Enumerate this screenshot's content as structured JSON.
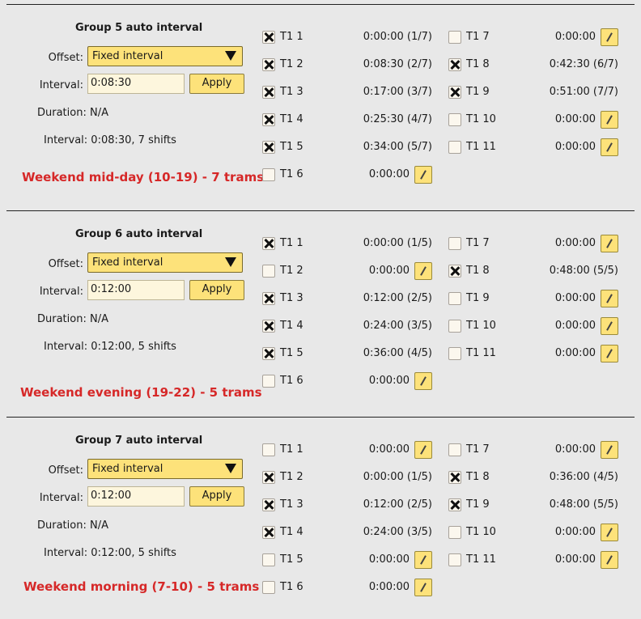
{
  "common": {
    "offset_label": "Offset:",
    "interval_label": "Interval:",
    "apply_label": "Apply",
    "duration_text": "Duration: N/A"
  },
  "groups": [
    {
      "title": "Group 5 auto interval",
      "offset_value": "Fixed interval",
      "interval_value": "0:08:30",
      "interval_info": "Interval: 0:08:30, 7 shifts",
      "footer": "Weekend mid-day (10-19) - 7 trams",
      "trams": [
        {
          "label": "T1 1",
          "checked": true,
          "value": "0:00:00 (1/7)"
        },
        {
          "label": "T1 2",
          "checked": true,
          "value": "0:08:30 (2/7)"
        },
        {
          "label": "T1 3",
          "checked": true,
          "value": "0:17:00 (3/7)"
        },
        {
          "label": "T1 4",
          "checked": true,
          "value": "0:25:30 (4/7)"
        },
        {
          "label": "T1 5",
          "checked": true,
          "value": "0:34:00 (5/7)"
        },
        {
          "label": "T1 6",
          "checked": false,
          "value": "0:00:00"
        },
        {
          "label": "T1 7",
          "checked": false,
          "value": "0:00:00"
        },
        {
          "label": "T1 8",
          "checked": true,
          "value": "0:42:30 (6/7)"
        },
        {
          "label": "T1 9",
          "checked": true,
          "value": "0:51:00 (7/7)"
        },
        {
          "label": "T1 10",
          "checked": false,
          "value": "0:00:00"
        },
        {
          "label": "T1 11",
          "checked": false,
          "value": "0:00:00"
        }
      ]
    },
    {
      "title": "Group 6 auto interval",
      "offset_value": "Fixed interval",
      "interval_value": "0:12:00",
      "interval_info": "Interval: 0:12:00, 5 shifts",
      "footer": "Weekend evening (19-22) - 5 trams",
      "trams": [
        {
          "label": "T1 1",
          "checked": true,
          "value": "0:00:00 (1/5)"
        },
        {
          "label": "T1 2",
          "checked": false,
          "value": "0:00:00"
        },
        {
          "label": "T1 3",
          "checked": true,
          "value": "0:12:00 (2/5)"
        },
        {
          "label": "T1 4",
          "checked": true,
          "value": "0:24:00 (3/5)"
        },
        {
          "label": "T1 5",
          "checked": true,
          "value": "0:36:00 (4/5)"
        },
        {
          "label": "T1 6",
          "checked": false,
          "value": "0:00:00"
        },
        {
          "label": "T1 7",
          "checked": false,
          "value": "0:00:00"
        },
        {
          "label": "T1 8",
          "checked": true,
          "value": "0:48:00 (5/5)"
        },
        {
          "label": "T1 9",
          "checked": false,
          "value": "0:00:00"
        },
        {
          "label": "T1 10",
          "checked": false,
          "value": "0:00:00"
        },
        {
          "label": "T1 11",
          "checked": false,
          "value": "0:00:00"
        }
      ]
    },
    {
      "title": "Group 7 auto interval",
      "offset_value": "Fixed interval",
      "interval_value": "0:12:00",
      "interval_info": "Interval: 0:12:00, 5 shifts",
      "footer": "Weekend morning (7-10) - 5 trams",
      "trams": [
        {
          "label": "T1 1",
          "checked": false,
          "value": "0:00:00"
        },
        {
          "label": "T1 2",
          "checked": true,
          "value": "0:00:00 (1/5)"
        },
        {
          "label": "T1 3",
          "checked": true,
          "value": "0:12:00 (2/5)"
        },
        {
          "label": "T1 4",
          "checked": true,
          "value": "0:24:00 (3/5)"
        },
        {
          "label": "T1 5",
          "checked": false,
          "value": "0:00:00"
        },
        {
          "label": "T1 6",
          "checked": false,
          "value": "0:00:00"
        },
        {
          "label": "T1 7",
          "checked": false,
          "value": "0:00:00"
        },
        {
          "label": "T1 8",
          "checked": true,
          "value": "0:36:00 (4/5)"
        },
        {
          "label": "T1 9",
          "checked": true,
          "value": "0:48:00 (5/5)"
        },
        {
          "label": "T1 10",
          "checked": false,
          "value": "0:00:00"
        },
        {
          "label": "T1 11",
          "checked": false,
          "value": "0:00:00"
        }
      ]
    }
  ]
}
